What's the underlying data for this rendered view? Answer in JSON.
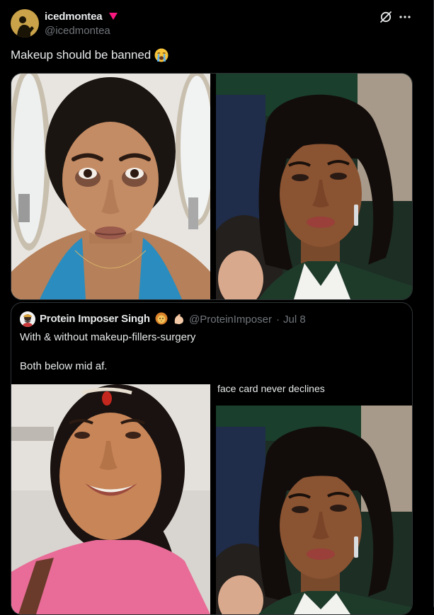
{
  "author": {
    "display_name": "icedmontea",
    "handle": "@icedmontea",
    "avatar_icon": "yellow-silhouette-avatar",
    "badge_icon": "pink-heart-triangle-icon"
  },
  "actions": {
    "grok_icon": "grok-icon",
    "more_icon": "more-options-icon"
  },
  "tweet": {
    "text": "Makeup should be banned",
    "emoji": "loudly-crying-face-emoji"
  },
  "media": {
    "photos": [
      {
        "name": "photo-without-makeup"
      },
      {
        "name": "photo-with-makeup"
      }
    ]
  },
  "quote": {
    "display_name": "Protein Imposer Singh",
    "emojis": [
      "lion-face-emoji",
      "flexed-biceps-emoji"
    ],
    "handle": "@ProteinImposer",
    "separator": "·",
    "date": "Jul 8",
    "line1": "With & without makeup-fillers-surgery",
    "line2": "Both below mid af.",
    "caption": "face card never declines"
  },
  "colors": {
    "background": "#000000",
    "text": "#e7e9ea",
    "muted": "#71767b",
    "border": "#2f3336",
    "badge": "#f91880"
  }
}
